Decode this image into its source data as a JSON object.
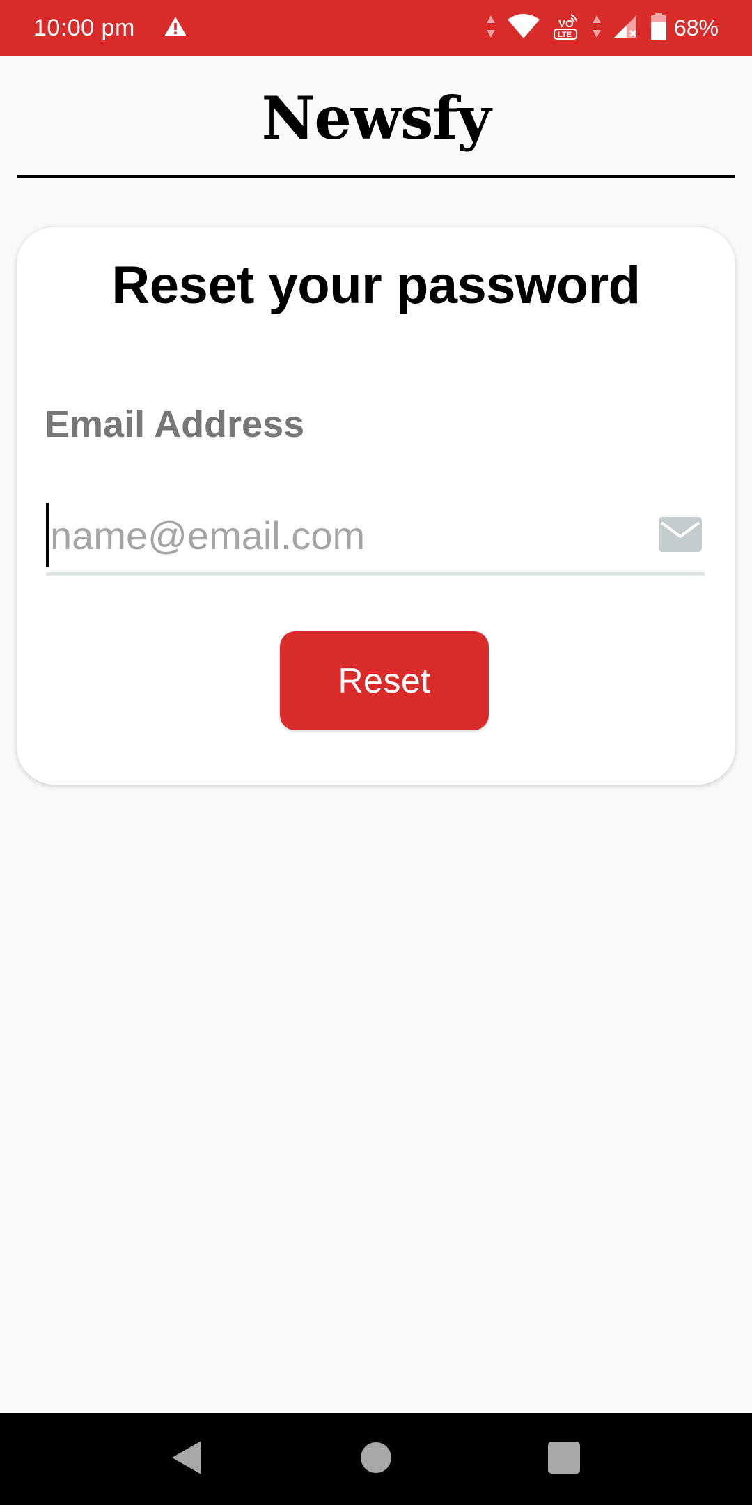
{
  "status_bar": {
    "time": "10:00 pm",
    "battery_text": "68%",
    "network_badge_top": "VO",
    "network_badge_bottom": "LTE",
    "background_color": "#d92b2a",
    "icons": [
      "alert-icon",
      "data-arrows-icon",
      "wifi-icon",
      "volte-icon",
      "signal-icon",
      "battery-icon"
    ]
  },
  "header": {
    "brand": "Newsfy"
  },
  "form": {
    "title": "Reset your password",
    "email_label": "Email Address",
    "email_placeholder": "name@email.com",
    "email_value": "",
    "email_icon": "mail-icon",
    "submit_label": "Reset",
    "accent_color": "#d92b2a"
  },
  "navigation": {
    "buttons": [
      "back-icon",
      "home-icon",
      "recents-icon"
    ]
  }
}
